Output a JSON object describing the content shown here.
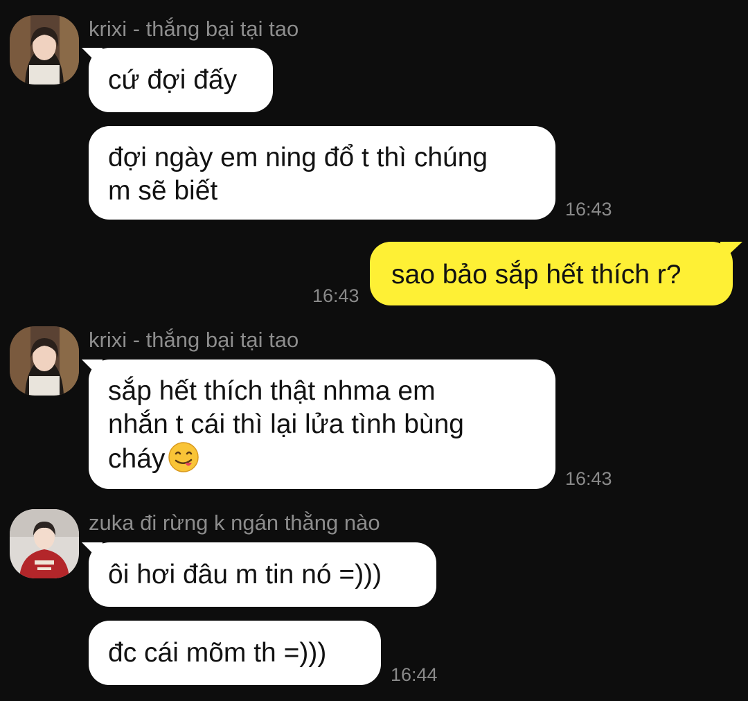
{
  "colors": {
    "background": "#0d0d0d",
    "incoming_bubble": "#ffffff",
    "outgoing_bubble": "#fef035",
    "sender_text": "#8d8d8d",
    "timestamp_text": "#8a8a8a"
  },
  "groups": [
    {
      "sender": "krixi - thắng bại tại tao",
      "avatar": "avatar-krixi",
      "messages": [
        {
          "text": "cứ đợi đấy"
        },
        {
          "text": "đợi ngày em ning đổ t thì chúng\nm sẽ biết"
        }
      ],
      "time": "16:43"
    },
    {
      "sender": "me",
      "messages": [
        {
          "text": "sao bảo sắp hết thích r?"
        }
      ],
      "time": "16:43"
    },
    {
      "sender": "krixi - thắng bại tại tao",
      "avatar": "avatar-krixi",
      "messages": [
        {
          "text": "sắp hết thích thật nhma em\nnhắn t cái thì lại lửa tình bùng\ncháy",
          "emoji": "face-savoring-food-emoji"
        }
      ],
      "time": "16:43"
    },
    {
      "sender": "zuka đi rừng k ngán thằng nào",
      "avatar": "avatar-zuka",
      "messages": [
        {
          "text": "ôi hơi đâu m tin nó =)))"
        },
        {
          "text": "đc cái mõm th =)))"
        }
      ],
      "time": "16:44"
    }
  ]
}
